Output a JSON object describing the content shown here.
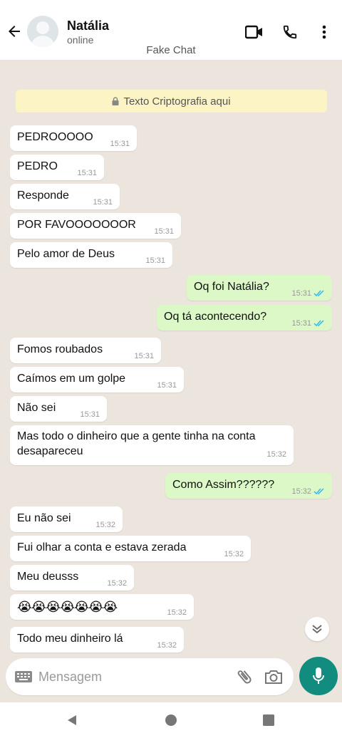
{
  "header": {
    "contact_name": "Natália",
    "status": "online",
    "app_title": "Fake Chat",
    "icons": [
      "back-arrow-icon",
      "video-call-icon",
      "phone-icon",
      "more-options-icon"
    ]
  },
  "chat": {
    "encryption_banner": "Texto Criptografia aqui",
    "messages": [
      {
        "dir": "in",
        "text": "PEDROOOOO",
        "time": "15:31"
      },
      {
        "dir": "in",
        "text": "PEDRO",
        "time": "15:31"
      },
      {
        "dir": "in",
        "text": "Responde",
        "time": "15:31"
      },
      {
        "dir": "in",
        "text": "POR FAVOOOOOOOR",
        "time": "15:31"
      },
      {
        "dir": "in",
        "text": "Pelo amor de Deus",
        "time": "15:31"
      },
      {
        "dir": "out",
        "text": "Oq foi Natália?",
        "time": "15:31",
        "read": true
      },
      {
        "dir": "out",
        "text": "Oq tá acontecendo?",
        "time": "15:31",
        "read": true
      },
      {
        "dir": "in",
        "text": "Fomos roubados",
        "time": "15:31"
      },
      {
        "dir": "in",
        "text": "Caímos em um golpe",
        "time": "15:31"
      },
      {
        "dir": "in",
        "text": "Não sei",
        "time": "15:31"
      },
      {
        "dir": "in",
        "text": "Mas todo o dinheiro que a gente tinha na conta desapareceu",
        "time": "15:32"
      },
      {
        "dir": "out",
        "text": "Como Assim??????",
        "time": "15:32",
        "read": true
      },
      {
        "dir": "in",
        "text": "Eu não sei",
        "time": "15:32"
      },
      {
        "dir": "in",
        "text": "Fui olhar a conta e estava zerada",
        "time": "15:32"
      },
      {
        "dir": "in",
        "text": "Meu deusss",
        "time": "15:32"
      },
      {
        "dir": "in",
        "text": "😭😭😭😭😭😭😭",
        "time": "15:32"
      },
      {
        "dir": "in",
        "text": "Todo meu dinheiro lá",
        "time": "15:32"
      }
    ]
  },
  "input": {
    "placeholder": "Mensagem",
    "value": ""
  },
  "colors": {
    "chat_bg": "#ece5dd",
    "incoming_bubble": "#ffffff",
    "outgoing_bubble": "#dcf8c6",
    "read_ticks": "#34b7f1",
    "mic_button": "#128c7e",
    "banner": "#fcf4c4"
  }
}
